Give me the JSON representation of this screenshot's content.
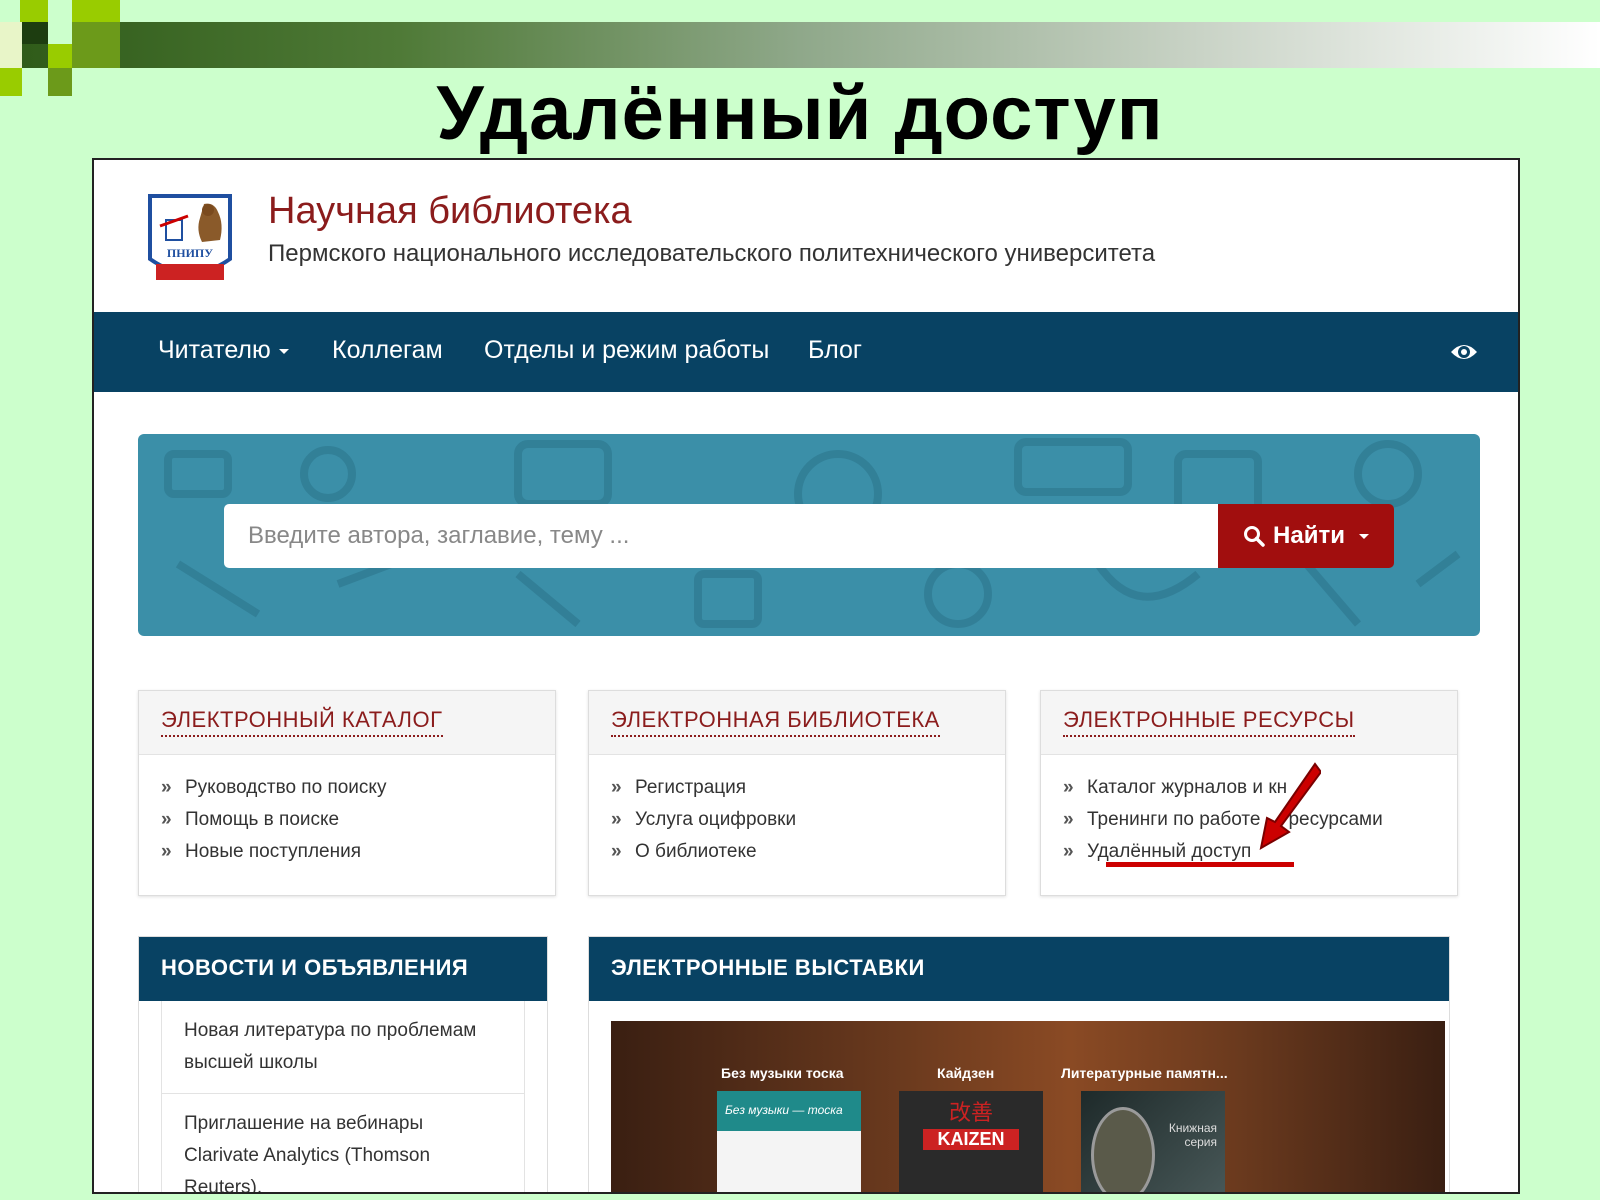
{
  "slide": {
    "title": "Удалённый доступ"
  },
  "header": {
    "logo_text": "ПНИПУ",
    "title": "Научная библиотека",
    "subtitle": "Пермского национального исследовательского политехнического университета"
  },
  "nav": {
    "items": [
      {
        "label": "Читателю",
        "dropdown": true
      },
      {
        "label": "Коллегам"
      },
      {
        "label": "Отделы и режим работы"
      },
      {
        "label": "Блог"
      }
    ],
    "right_icon": "eye-icon"
  },
  "search": {
    "placeholder": "Введите автора, заглавие, тему ...",
    "button_label": "Найти",
    "button_icon": "search-icon"
  },
  "panels": [
    {
      "title": "Электронный каталог",
      "links": [
        "Руководство по поиску",
        "Помощь в поиске",
        "Новые поступления"
      ]
    },
    {
      "title": "Электронная библиотека",
      "links": [
        "Регистрация",
        "Услуга оцифровки",
        "О библиотеке"
      ]
    },
    {
      "title": "Электронные ресурсы",
      "links": [
        "Каталог журналов и кн",
        "Тренинги по работе",
        "ресурсами",
        "Удалённый доступ"
      ]
    }
  ],
  "news": {
    "title": "Новости и объявления",
    "items": [
      "Новая литература по проблемам высшей школы",
      "Приглашение на вебинары Clarivate Analytics (Thomson Reuters),"
    ]
  },
  "exhibits": {
    "title": "Электронные выставки",
    "books": [
      {
        "title": "Без музыки тоска",
        "cover_text": "Без музыки — тоска"
      },
      {
        "title": "Кайдзен",
        "cover_text": "KAIZEN",
        "cover_glyphs": "改善"
      },
      {
        "title": "Литературные памятн...",
        "cover_text": "Книжная серия"
      }
    ]
  },
  "colors": {
    "slide_bg": "#ccffcc",
    "nav_bg": "#084263",
    "brand_red": "#8b1c1c",
    "button_red": "#a10e0e",
    "hero_bg": "#3b8fa8",
    "annotation_red": "#cc0000"
  }
}
